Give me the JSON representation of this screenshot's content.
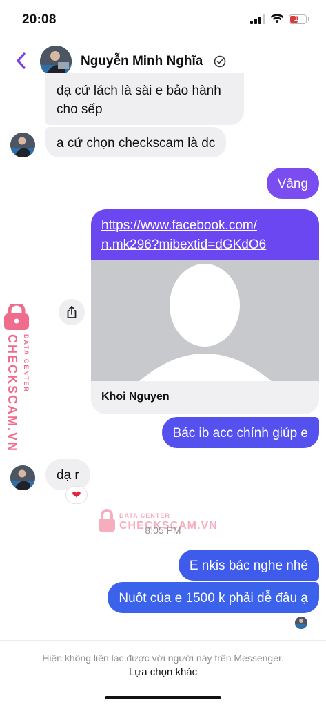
{
  "status_bar": {
    "time": "20:08",
    "battery": "11"
  },
  "header": {
    "contact_name": "Nguyễn Minh Nghĩa",
    "verified_icon": "check-circle-icon"
  },
  "messages": [
    {
      "side": "received",
      "text_lines": [
        "dạ cứ lách là sài e bảo hành",
        "cho sếp"
      ]
    },
    {
      "side": "received",
      "text": "a cứ chọn checkscam là dc"
    },
    {
      "side": "sent",
      "text": "Vâng"
    },
    {
      "side": "sent",
      "type": "link-card",
      "url_lines": [
        "https://www.facebook.com/",
        "n.mk296?mibextid=dGKdO6"
      ],
      "card_title": "Khoi Nguyen"
    },
    {
      "side": "sent",
      "text": "Bác ib acc chính giúp e"
    },
    {
      "side": "received",
      "text": "dạ r",
      "reaction": "❤"
    },
    {
      "side": "sent",
      "text": "E nkis bác nghe nhé"
    },
    {
      "side": "sent",
      "text": "Nuốt của e 1500 k phải dễ đâu ạ"
    }
  ],
  "timestamp": "8:05 PM",
  "watermark": {
    "brand": "CHECKSCAM.VN",
    "sub": "DATA CENTER"
  },
  "footer": {
    "notice": "Hiện không liên lạc được với người này trên Messenger.",
    "action": "Lựa chọn khác"
  },
  "colors": {
    "sent_purple": "#6048f0",
    "sent_blue": "#4357ec",
    "received_gray": "#efeff1",
    "back_arrow": "#7b3fe4",
    "watermark_pink": "#f06c8c"
  }
}
